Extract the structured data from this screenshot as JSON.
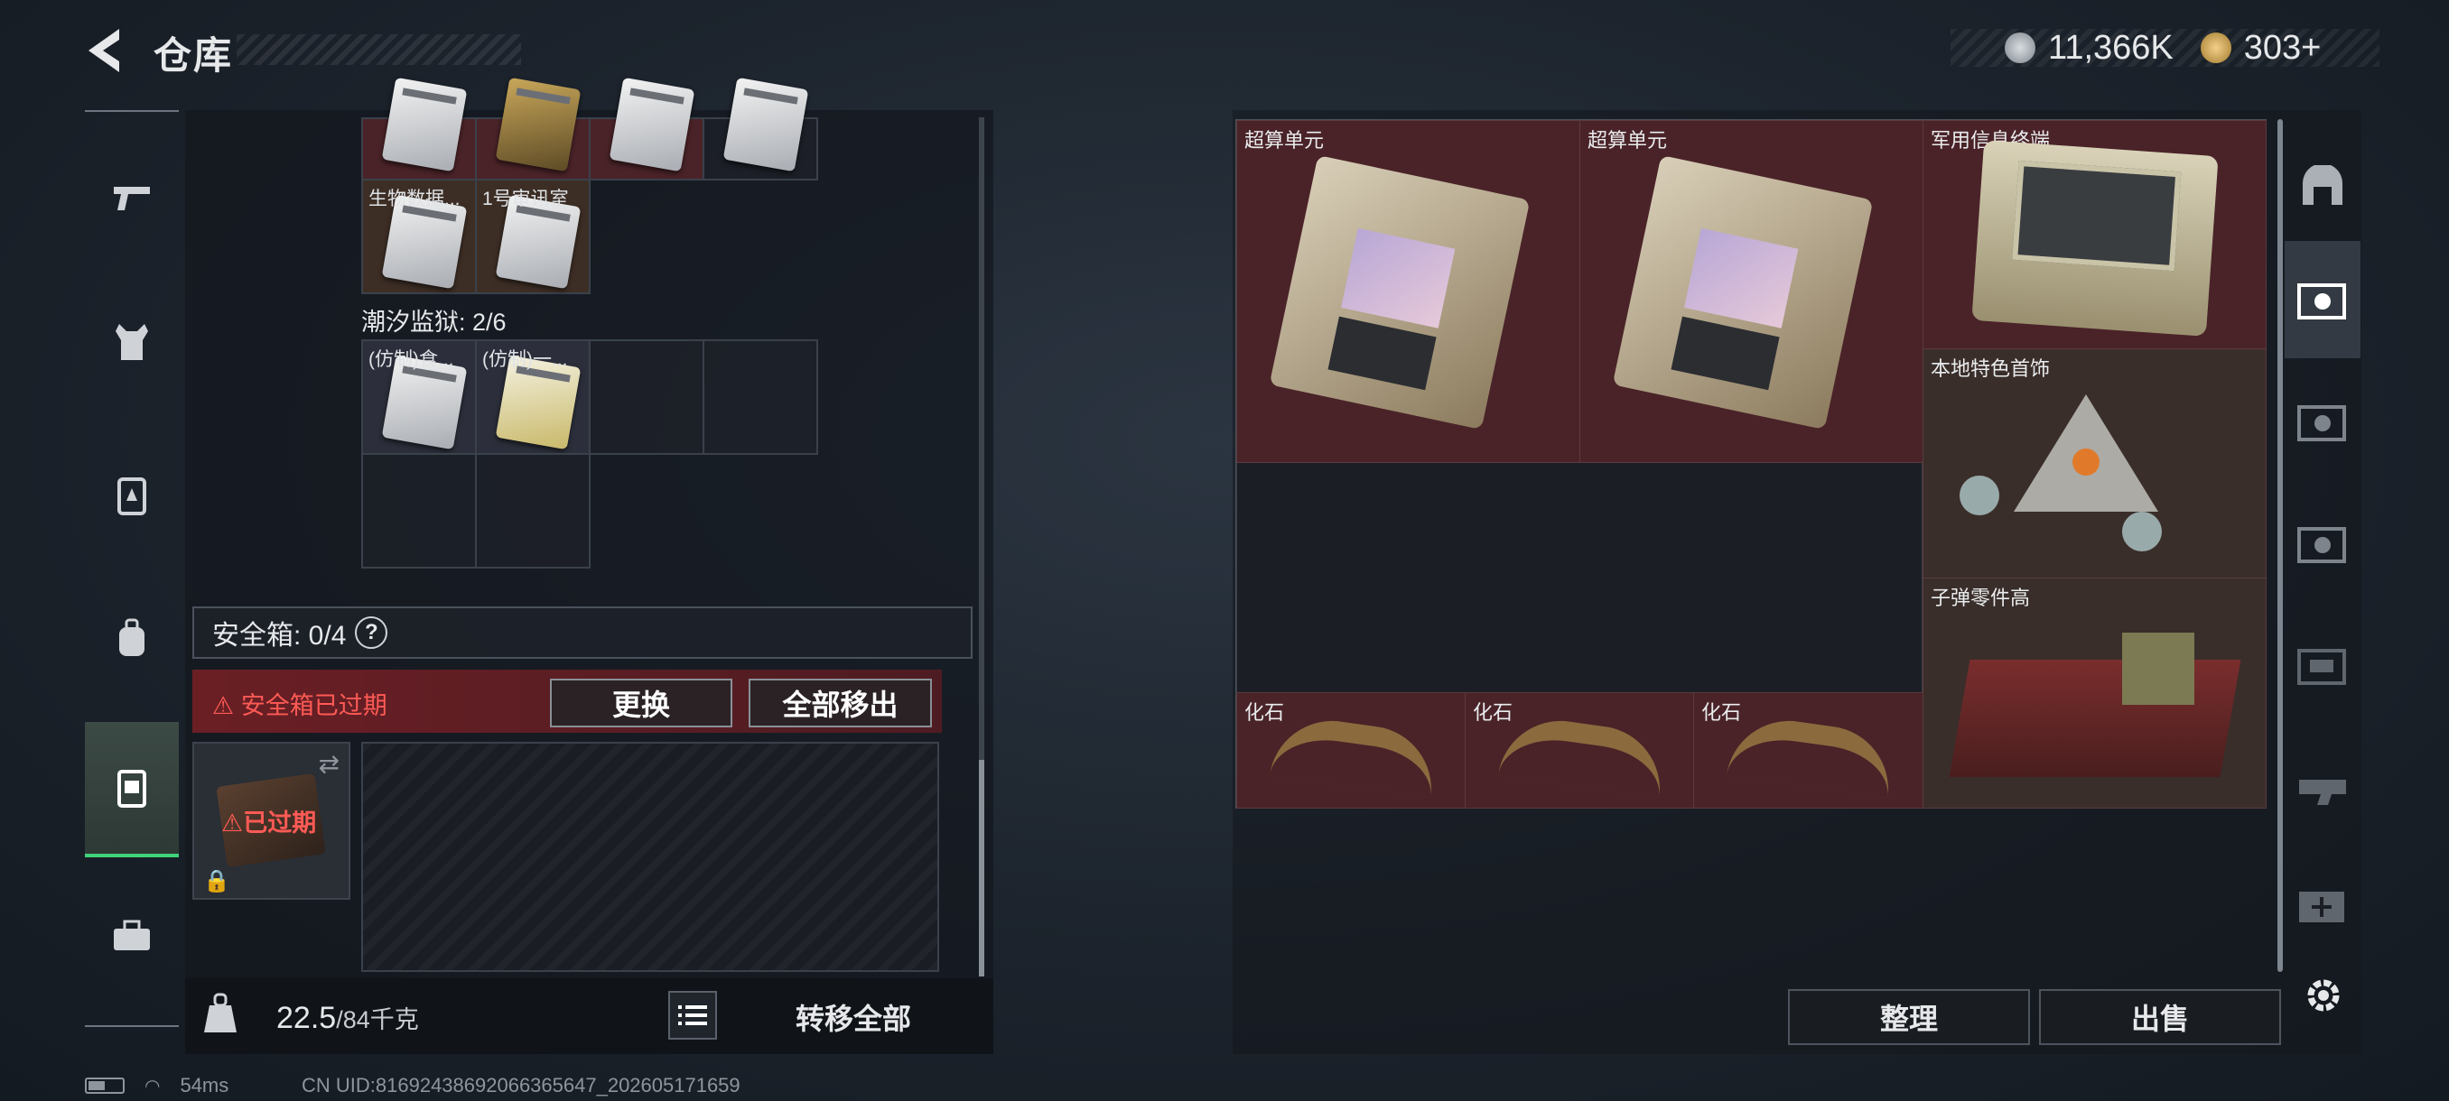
{
  "header": {
    "title": "仓库"
  },
  "currency": {
    "coins": "11,366K",
    "tickets": "303+"
  },
  "left_nav": {
    "items": [
      "weapon",
      "armor",
      "chest-rig",
      "backpack",
      "safe-box",
      "toolbox"
    ]
  },
  "containers": {
    "top_items": [
      {
        "label": ""
      },
      {
        "label": ""
      },
      {
        "label": ""
      },
      {
        "label": ""
      }
    ],
    "row2": [
      {
        "label": "生物数据..."
      },
      {
        "label": "1号审讯室"
      }
    ],
    "section_label": "潮汐监狱: 2/6",
    "row3": [
      {
        "label": "(仿制)食..."
      },
      {
        "label": "(仿制)一..."
      }
    ]
  },
  "safe_box": {
    "label": "安全箱: 0/4",
    "help": "?",
    "expired_warning": "安全箱已过期",
    "replace_label": "更换",
    "move_all_label": "全部移出",
    "slot_badge": "已过期"
  },
  "weight": {
    "current": "22.5",
    "max": "/84千克",
    "transfer_all": "转移全部"
  },
  "stash": {
    "items": [
      {
        "label": "超算单元"
      },
      {
        "label": "超算单元"
      },
      {
        "label": "军用信息终端"
      },
      {
        "label": "本地特色首饰"
      },
      {
        "label": "子弹零件高"
      },
      {
        "label": "化石"
      },
      {
        "label": "化石"
      },
      {
        "label": "化石"
      }
    ]
  },
  "bottom_buttons": {
    "sort": "整理",
    "sell": "出售"
  },
  "status": {
    "ping": "54ms",
    "uid": "CN UID:81692438692066365647_202605171659"
  },
  "colors": {
    "accent_green": "#3fd37a",
    "danger_red": "#ff5a55",
    "item_red": "#4a2328"
  }
}
